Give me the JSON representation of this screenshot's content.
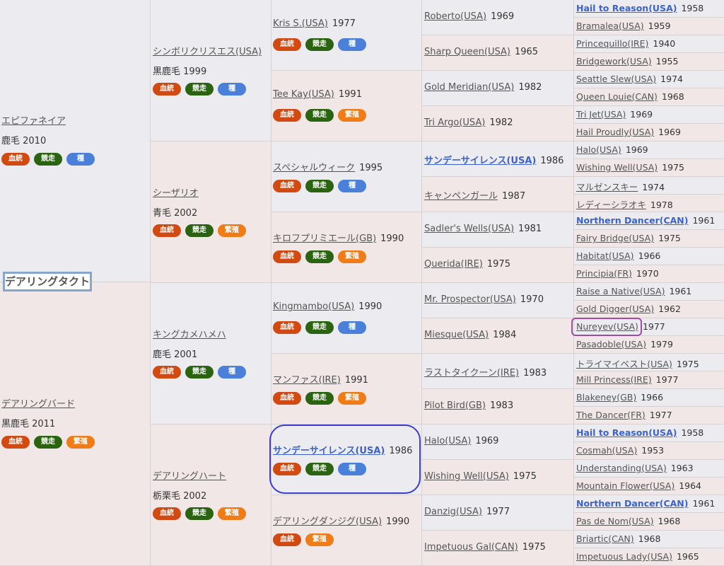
{
  "subject": "デアリングタクト",
  "badge_labels": {
    "ketto": "血統",
    "kyoso": "競走",
    "tane": "種",
    "hanshoku": "繁殖"
  },
  "gen1": [
    {
      "name": "エピファネイア",
      "info": "鹿毛 2010",
      "badges": [
        "ketto",
        "kyoso",
        "tane"
      ]
    },
    {
      "name": "デアリングバード",
      "info": "黒鹿毛 2011",
      "badges": [
        "ketto",
        "kyoso",
        "hanshoku"
      ]
    }
  ],
  "gen2": [
    {
      "name": "シンボリクリスエス(USA)",
      "info": "黒鹿毛 1999",
      "badges": [
        "ketto",
        "kyoso",
        "tane"
      ]
    },
    {
      "name": "シーザリオ",
      "info": "青毛 2002",
      "badges": [
        "ketto",
        "kyoso",
        "hanshoku"
      ]
    },
    {
      "name": "キングカメハメハ",
      "info": "鹿毛 2001",
      "badges": [
        "ketto",
        "kyoso",
        "tane"
      ]
    },
    {
      "name": "デアリングハート",
      "info": "栃栗毛 2002",
      "badges": [
        "ketto",
        "kyoso",
        "hanshoku"
      ]
    }
  ],
  "gen3": [
    {
      "name": "Kris S.(USA)",
      "year": "1977",
      "badges": [
        "ketto",
        "kyoso",
        "tane"
      ]
    },
    {
      "name": "Tee Kay(USA)",
      "year": "1991",
      "badges": [
        "ketto",
        "kyoso",
        "hanshoku"
      ]
    },
    {
      "name": "スペシャルウィーク",
      "year": "1995",
      "badges": [
        "ketto",
        "kyoso",
        "tane"
      ]
    },
    {
      "name": "キロフプリミエール(GB)",
      "year": "1990",
      "badges": [
        "ketto",
        "kyoso",
        "hanshoku"
      ]
    },
    {
      "name": "Kingmambo(USA)",
      "year": "1990",
      "badges": [
        "ketto",
        "kyoso",
        "tane"
      ]
    },
    {
      "name": "マンファス(IRE)",
      "year": "1991",
      "badges": [
        "ketto",
        "kyoso",
        "hanshoku"
      ]
    },
    {
      "name": "サンデーサイレンス(USA)",
      "year": "1986",
      "badges": [
        "ketto",
        "kyoso",
        "tane"
      ],
      "bold": true
    },
    {
      "name": "デアリングダンジグ(USA)",
      "year": "1990",
      "badges": [
        "ketto",
        "hanshoku"
      ]
    }
  ],
  "gen4": [
    {
      "name": "Roberto(USA)",
      "year": "1969"
    },
    {
      "name": "Sharp Queen(USA)",
      "year": "1965"
    },
    {
      "name": "Gold Meridian(USA)",
      "year": "1982"
    },
    {
      "name": "Tri Argo(USA)",
      "year": "1982"
    },
    {
      "name": "サンデーサイレンス(USA)",
      "year": "1986",
      "bold": true
    },
    {
      "name": "キャンペンガール",
      "year": "1987"
    },
    {
      "name": "Sadler's Wells(USA)",
      "year": "1981"
    },
    {
      "name": "Querida(IRE)",
      "year": "1975"
    },
    {
      "name": "Mr. Prospector(USA)",
      "year": "1970"
    },
    {
      "name": "Miesque(USA)",
      "year": "1984"
    },
    {
      "name": "ラストタイクーン(IRE)",
      "year": "1983"
    },
    {
      "name": "Pilot Bird(GB)",
      "year": "1983"
    },
    {
      "name": "Halo(USA)",
      "year": "1969"
    },
    {
      "name": "Wishing Well(USA)",
      "year": "1975"
    },
    {
      "name": "Danzig(USA)",
      "year": "1977"
    },
    {
      "name": "Impetuous Gal(CAN)",
      "year": "1975"
    }
  ],
  "gen5": [
    {
      "name": "Hail to Reason(USA)",
      "year": "1958",
      "bold": true
    },
    {
      "name": "Bramalea(USA)",
      "year": "1959"
    },
    {
      "name": "Princequillo(IRE)",
      "year": "1940"
    },
    {
      "name": "Bridgework(USA)",
      "year": "1955"
    },
    {
      "name": "Seattle Slew(USA)",
      "year": "1974"
    },
    {
      "name": "Queen Louie(CAN)",
      "year": "1968"
    },
    {
      "name": "Tri Jet(USA)",
      "year": "1969"
    },
    {
      "name": "Hail Proudly(USA)",
      "year": "1969"
    },
    {
      "name": "Halo(USA)",
      "year": "1969"
    },
    {
      "name": "Wishing Well(USA)",
      "year": "1975"
    },
    {
      "name": "マルゼンスキー",
      "year": "1974"
    },
    {
      "name": "レディーシラオキ",
      "year": "1978"
    },
    {
      "name": "Northern Dancer(CAN)",
      "year": "1961",
      "bold": true
    },
    {
      "name": "Fairy Bridge(USA)",
      "year": "1975"
    },
    {
      "name": "Habitat(USA)",
      "year": "1966"
    },
    {
      "name": "Principia(FR)",
      "year": "1970"
    },
    {
      "name": "Raise a Native(USA)",
      "year": "1961"
    },
    {
      "name": "Gold Digger(USA)",
      "year": "1962"
    },
    {
      "name": "Nureyev(USA)",
      "year": "1977"
    },
    {
      "name": "Pasadoble(USA)",
      "year": "1979"
    },
    {
      "name": "トライマイベスト(USA)",
      "year": "1975"
    },
    {
      "name": "Mill Princess(IRE)",
      "year": "1977"
    },
    {
      "name": "Blakeney(GB)",
      "year": "1966"
    },
    {
      "name": "The Dancer(FR)",
      "year": "1977"
    },
    {
      "name": "Hail to Reason(USA)",
      "year": "1958",
      "bold": true
    },
    {
      "name": "Cosmah(USA)",
      "year": "1953"
    },
    {
      "name": "Understanding(USA)",
      "year": "1963"
    },
    {
      "name": "Mountain Flower(USA)",
      "year": "1964"
    },
    {
      "name": "Northern Dancer(CAN)",
      "year": "1961",
      "bold": true
    },
    {
      "name": "Pas de Nom(USA)",
      "year": "1968"
    },
    {
      "name": "Briartic(CAN)",
      "year": "1968"
    },
    {
      "name": "Impetuous Lady(USA)",
      "year": "1965"
    }
  ]
}
